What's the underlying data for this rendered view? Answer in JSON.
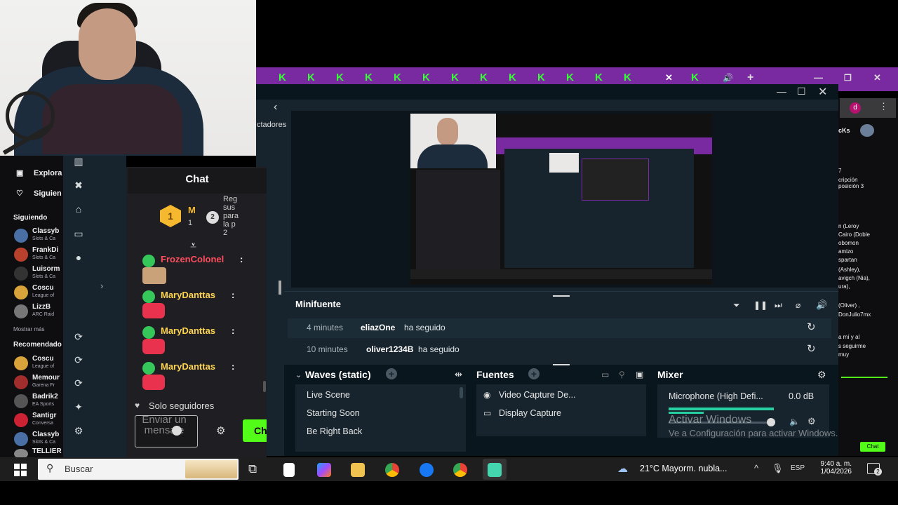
{
  "chat": {
    "header": "Chat",
    "leaderboard": {
      "first_rank": "1",
      "first_initial": "M",
      "first_count": "1",
      "second_rank": "2",
      "second_lines": [
        "Reg",
        "sus",
        "para",
        "la p",
        "2"
      ]
    },
    "messages": [
      {
        "user": "FrozenColonel",
        "color": "#ff4d5e"
      },
      {
        "user": "MaryDanttas",
        "color": "#ffd54f"
      },
      {
        "user": "MaryDanttas",
        "color": "#ffd54f"
      },
      {
        "user": "MaryDanttas",
        "color": "#ffd54f"
      }
    ],
    "mode": "Solo seguidores",
    "input_placeholder": "Enviar un mensaje",
    "send_label": "Ch"
  },
  "browser_sidebar": {
    "nav": [
      "Explora",
      "Siguien"
    ],
    "following_heading": "Siguiendo",
    "following": [
      {
        "name": "Classyb",
        "game": "Slots & Ca",
        "color": "#4a6fa5"
      },
      {
        "name": "FrankDi",
        "game": "Slots & Ca",
        "color": "#b8412e"
      },
      {
        "name": "Luisorm",
        "game": "Slots & Ca",
        "color": "#333"
      },
      {
        "name": "Coscu",
        "game": "League of",
        "color": "#d8a33a"
      },
      {
        "name": "LizzB",
        "game": "ARC Raid",
        "color": "#777"
      }
    ],
    "show_more": "Mostrar más",
    "recommended_heading": "Recomendado",
    "recommended": [
      {
        "name": "Coscu",
        "game": "League of",
        "color": "#d8a33a"
      },
      {
        "name": "Memour",
        "game": "Garena Fr",
        "color": "#a12d2d"
      },
      {
        "name": "Badrik2",
        "game": "EA Sports",
        "color": "#555"
      },
      {
        "name": "Santigr",
        "game": "Conversa",
        "color": "#c23"
      },
      {
        "name": "Classyb",
        "game": "Slots & Ca",
        "color": "#4a6fa5"
      },
      {
        "name": "TELLIER",
        "game": "",
        "color": "#888"
      }
    ],
    "viewers_fragment": "ctadores"
  },
  "minifuente": {
    "title": "Minifuente",
    "events": [
      {
        "time": "4 minutes",
        "user": "eliazOne",
        "action": "ha seguido"
      },
      {
        "time": "10 minutes",
        "user": "oliver1234B",
        "action": "ha seguido"
      }
    ]
  },
  "scenes": {
    "title": "Waves (static)",
    "items": [
      "Live Scene",
      "Starting Soon",
      "Be Right Back"
    ]
  },
  "sources": {
    "title": "Fuentes",
    "items": [
      "Video Capture De...",
      "Display Capture"
    ]
  },
  "mixer": {
    "title": "Mixer",
    "channel": "Microphone (High Defi...",
    "level": "0.0 dB",
    "watermark_line1": "Activar Windows",
    "watermark_line2": "Ve a Configuración para activar Windows."
  },
  "right_panel": {
    "lines": [
      "cKs",
      "7",
      "cripción",
      "posición 3",
      "n (Leroy",
      "Cairo (Doble",
      "obomon",
      "amizo",
      "spartan",
      "(Ashley),",
      "avigch (Nia),",
      "ura),",
      "(Oliver) ,",
      "DonJulio7mx",
      "a mí y al",
      "s seguirme",
      "muy"
    ],
    "avatar_letter": "d",
    "chat_button": "Chat"
  },
  "taskbar": {
    "search_placeholder": "Buscar",
    "weather": "21°C  Mayorm. nubla...",
    "language": "ESP",
    "time": "9:40 a. m.",
    "date": "1/04/2026",
    "notifications": "2"
  }
}
